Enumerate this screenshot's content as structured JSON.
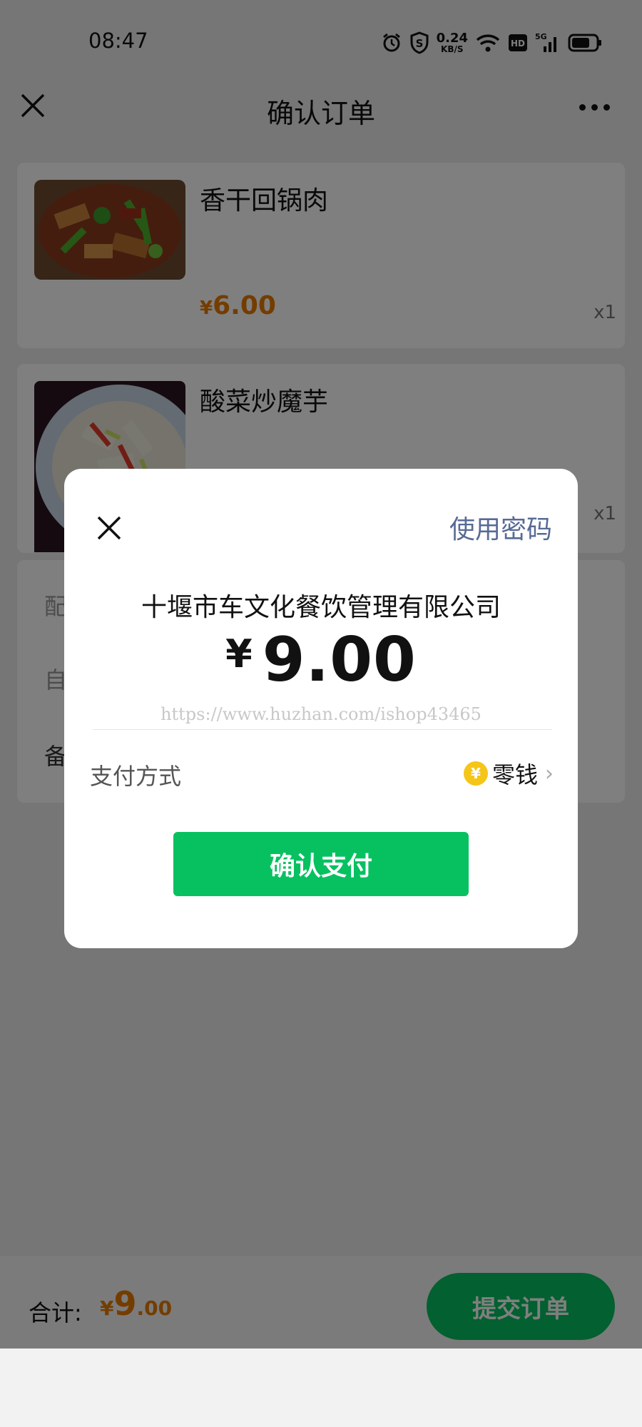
{
  "status_bar": {
    "time": "08:47",
    "speed_value": "0.24",
    "speed_unit": "KB/S",
    "hd": "HD",
    "network": "5G"
  },
  "nav": {
    "title": "确认订单"
  },
  "items": [
    {
      "name": "香干回锅肉",
      "price_symbol": "¥",
      "price": "6.00",
      "qty": "x1"
    },
    {
      "name": "酸菜炒魔芋",
      "qty": "x1"
    }
  ],
  "other_section": {
    "rows": [
      "配",
      "自",
      "备"
    ]
  },
  "bottom_bar": {
    "total_label": "合计:",
    "total_symbol": "¥",
    "total_int": "9",
    "total_dec": ".00",
    "submit_label": "提交订单"
  },
  "dialog": {
    "use_password_label": "使用密码",
    "merchant": "十堰市车文化餐饮管理有限公司",
    "currency_symbol": "¥",
    "amount": "9.00",
    "watermark": "https://www.huzhan.com/ishop43465",
    "payment_method_label": "支付方式",
    "payment_method_value": "零钱",
    "coin_symbol": "¥",
    "confirm_label": "确认支付"
  },
  "colors": {
    "brand_green": "#07c160",
    "price_orange": "#e87a00",
    "link_blue": "#576b95"
  }
}
